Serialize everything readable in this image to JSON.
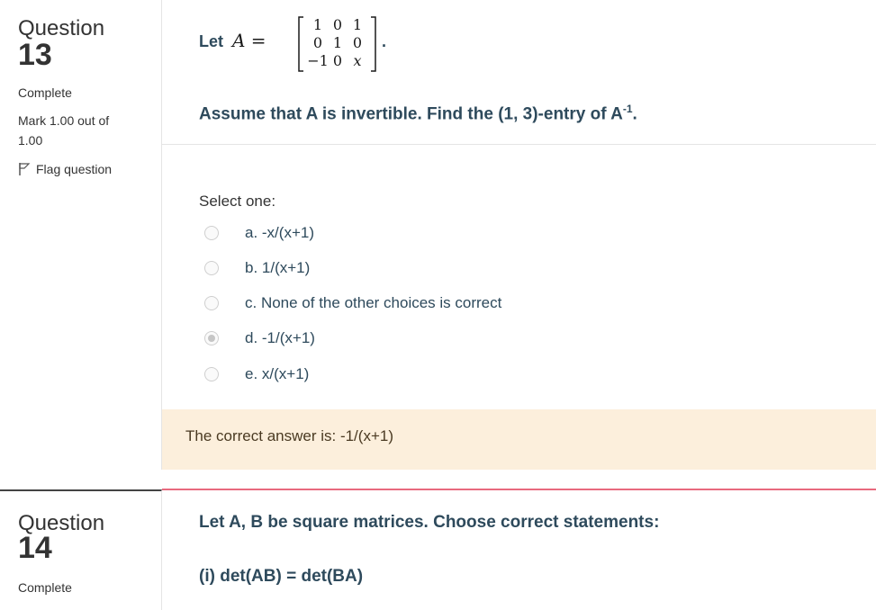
{
  "q13": {
    "label": "Question",
    "number": "13",
    "state": "Complete",
    "mark_line1": "Mark 1.00 out of",
    "mark_line2": "1.00",
    "flag": "Flag question",
    "let_prefix": "Let",
    "matrix_name": "A =",
    "matrix": [
      [
        "1",
        "0",
        "1"
      ],
      [
        "0",
        "1",
        "0"
      ],
      [
        "−1",
        "0",
        "x"
      ]
    ],
    "matrix_period": ".",
    "prompt": "Assume that A is invertible. Find the (1, 3)-entry of A",
    "prompt_sup": "-1",
    "prompt_end": ".",
    "select_one": "Select one:",
    "options": [
      {
        "label": "a. -x/(x+1)",
        "checked": false
      },
      {
        "label": "b. 1/(x+1)",
        "checked": false
      },
      {
        "label": "c. None of the other choices is correct",
        "checked": false
      },
      {
        "label": "d. -1/(x+1)",
        "checked": true
      },
      {
        "label": "e. x/(x+1)",
        "checked": false
      }
    ],
    "feedback": "The correct answer is: -1/(x+1)"
  },
  "q14": {
    "label": "Question",
    "number": "14",
    "state": "Complete",
    "prompt": "Let A, B be square matrices. Choose correct statements:",
    "statement1": "(i) det(AB) = det(BA)"
  },
  "colors": {
    "question_text": "#2e4a5c",
    "feedback_bg": "#fcefdc",
    "divider_red": "#e8697e"
  }
}
